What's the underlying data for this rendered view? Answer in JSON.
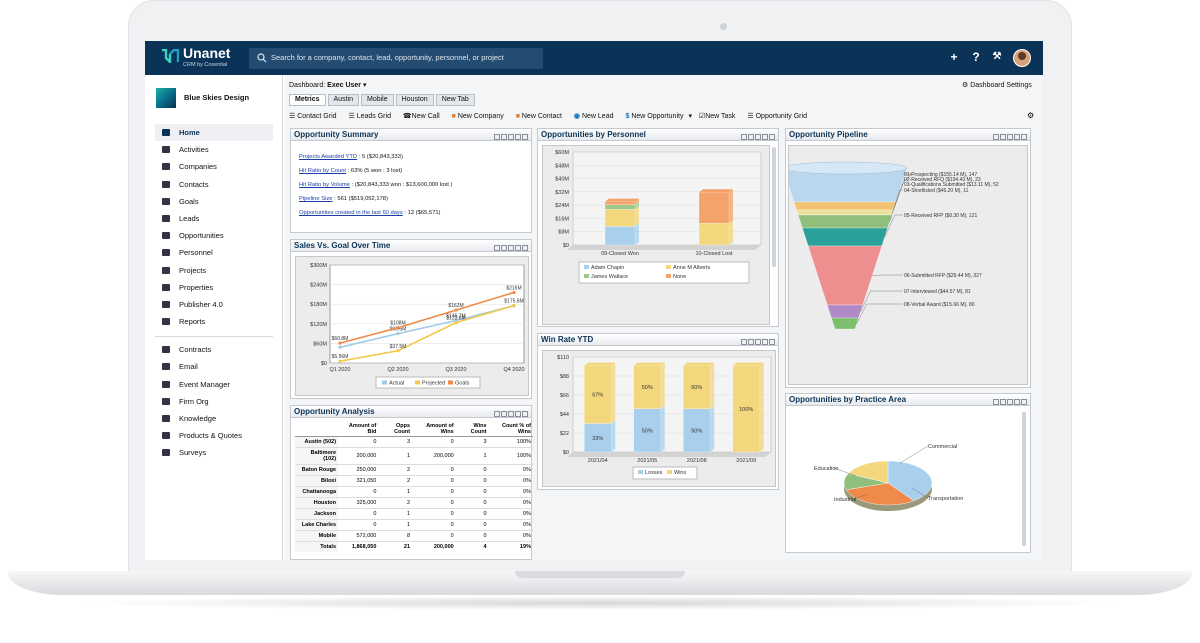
{
  "app": {
    "brand": "Unanet",
    "brand_sub": "CRM by Cosential",
    "search_placeholder": "Search for a company, contact, lead, opportunity, personnel, or project"
  },
  "org": {
    "name": "Blue Skies Design"
  },
  "nav": {
    "primary": [
      {
        "label": "Home",
        "icon": "home-icon"
      },
      {
        "label": "Activities",
        "icon": "list-icon"
      },
      {
        "label": "Companies",
        "icon": "building-icon"
      },
      {
        "label": "Contacts",
        "icon": "contact-icon"
      },
      {
        "label": "Goals",
        "icon": "trophy-icon"
      },
      {
        "label": "Leads",
        "icon": "leads-icon"
      },
      {
        "label": "Opportunities",
        "icon": "dollar-icon"
      },
      {
        "label": "Personnel",
        "icon": "person-icon"
      },
      {
        "label": "Projects",
        "icon": "briefcase-icon"
      },
      {
        "label": "Properties",
        "icon": "pin-icon"
      },
      {
        "label": "Publisher 4.0",
        "icon": "publisher-icon"
      },
      {
        "label": "Reports",
        "icon": "report-icon"
      }
    ],
    "secondary": [
      {
        "label": "Contracts",
        "icon": "contract-icon"
      },
      {
        "label": "Email",
        "icon": "email-icon"
      },
      {
        "label": "Event Manager",
        "icon": "calendar-icon"
      },
      {
        "label": "Firm Org",
        "icon": "org-icon"
      },
      {
        "label": "Knowledge",
        "icon": "bulb-icon"
      },
      {
        "label": "Products & Quotes",
        "icon": "tag-icon"
      },
      {
        "label": "Surveys",
        "icon": "survey-icon"
      }
    ]
  },
  "dashboard": {
    "label": "Dashboard:",
    "value": "Exec User",
    "settings": "Dashboard Settings"
  },
  "tabs": [
    "Metrics",
    "Austin",
    "Mobile",
    "Houston",
    "New Tab"
  ],
  "toolbar": [
    "Contact Grid",
    "Leads Grid",
    "New Call",
    "New Company",
    "New Contact",
    "New Lead",
    "New Opportunity",
    "New Task",
    "Opportunity Grid"
  ],
  "panels": {
    "summary": {
      "title": "Opportunity Summary",
      "rows": [
        {
          "link": "Projects Awarded YTD",
          "value": ": 5 ($20,843,333)"
        },
        {
          "link": "Hit Ratio by Count",
          "value": ": 63% (5 won : 3 lost)"
        },
        {
          "link": "Hit Ratio by Volume",
          "value": ": ($20,843,333 won : $13,600,000 lost )"
        },
        {
          "link": "Pipeline Size",
          "value": ": 561 ($519,052,178)"
        },
        {
          "link": "Opportunities created in the last 60 days",
          "value": ": 12 ($65,571)"
        }
      ]
    },
    "sales_goal": {
      "title": "Sales Vs. Goal Over Time"
    },
    "analysis": {
      "title": "Opportunity Analysis",
      "headers": [
        "",
        "Amount of Bid",
        "Opps Count",
        "Amount of Wins",
        "Wins Count",
        "Count % of Wins"
      ],
      "rows": [
        [
          "Austin (502)",
          "0",
          "3",
          "0",
          "3",
          "100%"
        ],
        [
          "Baltimore (102)",
          "200,000",
          "1",
          "200,000",
          "1",
          "100%"
        ],
        [
          "Baton Rouge",
          "250,000",
          "2",
          "0",
          "0",
          "0%"
        ],
        [
          "Biloxi",
          "321,050",
          "2",
          "0",
          "0",
          "0%"
        ],
        [
          "Chattanooga",
          "0",
          "1",
          "0",
          "0",
          "0%"
        ],
        [
          "Houston",
          "325,000",
          "2",
          "0",
          "0",
          "0%"
        ],
        [
          "Jackson",
          "0",
          "1",
          "0",
          "0",
          "0%"
        ],
        [
          "Lake Charles",
          "0",
          "1",
          "0",
          "0",
          "0%"
        ],
        [
          "Mobile",
          "572,000",
          "8",
          "0",
          "0",
          "0%"
        ],
        [
          "Totals",
          "1,868,050",
          "21",
          "200,000",
          "4",
          "19%"
        ]
      ]
    },
    "personnel": {
      "title": "Opportunities by Personnel"
    },
    "winrate": {
      "title": "Win Rate YTD"
    },
    "pipeline": {
      "title": "Opportunity Pipeline"
    },
    "practice": {
      "title": "Opportunities by Practice Area"
    }
  },
  "chart_data": [
    {
      "type": "line",
      "title": "Sales Vs. Goal Over Time",
      "categories": [
        "Q1 2020",
        "Q2 2020",
        "Q3 2020",
        "Q4 2020"
      ],
      "ylim": [
        0,
        300
      ],
      "yticks": [
        "$0",
        "$60M",
        "$120M",
        "$180M",
        "$240M",
        "$300M"
      ],
      "series": [
        {
          "name": "Actual",
          "color": "#9fcbe8",
          "values": [
            48,
            90,
            130,
            175
          ],
          "labels": [
            "",
            "$90.6M",
            "$145.7M",
            ""
          ]
        },
        {
          "name": "Projected",
          "color": "#f2c84b",
          "values": [
            5.56,
            37.5,
            123.6,
            175.6
          ],
          "labels": [
            "$5.56M",
            "$37.5M",
            "$123.6M",
            "$175.6M"
          ]
        },
        {
          "name": "Goals",
          "color": "#f08a4b",
          "values": [
            60.8,
            108,
            162,
            216
          ],
          "labels": [
            "$60.8M",
            "$108M",
            "$162M",
            "$216M"
          ]
        }
      ]
    },
    {
      "type": "bar",
      "title": "Opportunities by Personnel",
      "categories": [
        "09-Closed Won",
        "10-Closed Lost"
      ],
      "yticks": [
        "$0",
        "$8M",
        "$16M",
        "$24M",
        "$32M",
        "$40M",
        "$48M",
        "$60M"
      ],
      "ylim": [
        0,
        60
      ],
      "series": [
        {
          "name": "Adam Chapin",
          "color": "#a8d0ec",
          "values": [
            12,
            0
          ]
        },
        {
          "name": "Anne M Alberts",
          "color": "#f2d77c",
          "values": [
            11,
            14
          ]
        },
        {
          "name": "James Wallace",
          "color": "#9ec98c",
          "values": [
            3,
            0
          ]
        },
        {
          "name": "None",
          "color": "#f4a36a",
          "values": [
            2,
            20
          ]
        }
      ]
    },
    {
      "type": "bar",
      "title": "Win Rate YTD",
      "categories": [
        "2021/04",
        "2021/05",
        "2021/08",
        "2021/09"
      ],
      "yticks": [
        "$0",
        "$22",
        "$44",
        "$66",
        "$88",
        "$110"
      ],
      "ylim": [
        0,
        110
      ],
      "series": [
        {
          "name": "Losses",
          "color": "#a8d0ec",
          "values": [
            33,
            50,
            50,
            0
          ],
          "labels": [
            "33%",
            "50%",
            "50%",
            "0%"
          ]
        },
        {
          "name": "Wins",
          "color": "#f2d77c",
          "values": [
            67,
            50,
            50,
            100
          ],
          "labels": [
            "67%",
            "50%",
            "50%",
            "100%"
          ]
        }
      ]
    },
    {
      "type": "funnel",
      "title": "Opportunity Pipeline",
      "stages": [
        {
          "label": "01-Prospecting ($155.14 M), 147",
          "color": "#b9d7ee"
        },
        {
          "label": "02-Received RFQ ($194.43 M), 23",
          "color": "#f2c471"
        },
        {
          "label": "03-Qualifications Submitted ($13.11 M), 52",
          "color": "#e8e19a"
        },
        {
          "label": "04-Shortlisted ($46.20 M), 11",
          "color": "#8fbf7a"
        },
        {
          "label": "05-Received RFP ($8.30 M), 121",
          "color": "#2aa199"
        },
        {
          "label": "06-Submitted RFP ($29.44 M), 327",
          "color": "#ee8f8f"
        },
        {
          "label": "07-Interviewed ($44.57 M), 81",
          "color": "#b089c7"
        },
        {
          "label": "08-Verbal Award ($15.66 M), 80",
          "color": "#7dbf6d"
        }
      ]
    },
    {
      "type": "pie",
      "title": "Opportunities by Practice Area",
      "slices": [
        {
          "label": "Commercial",
          "value": 40,
          "color": "#a8d0ec"
        },
        {
          "label": "Transportation",
          "value": 30,
          "color": "#f08a4b"
        },
        {
          "label": "Industrial",
          "value": 12,
          "color": "#8fbf7a"
        },
        {
          "label": "Education",
          "value": 18,
          "color": "#f2d77c"
        }
      ]
    }
  ]
}
